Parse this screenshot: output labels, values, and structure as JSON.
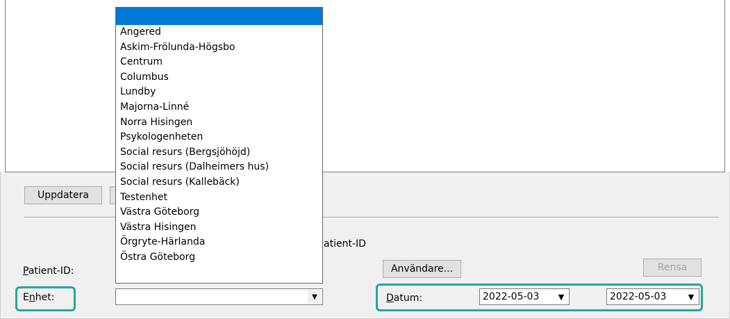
{
  "buttons": {
    "update": "Uppdatera",
    "users": "Användare...",
    "clear": "Rensa"
  },
  "labels": {
    "patient_id": "Patient-ID:",
    "patient_id_partial": "atient-ID",
    "unit": "Enhet:",
    "date": "Datum:"
  },
  "unit_dropdown": {
    "options": [
      "Angered",
      "Askim-Frölunda-Högsbo",
      "Centrum",
      "Columbus",
      "Lundby",
      "Majorna-Linné",
      "Norra Hisingen",
      "Psykologenheten",
      "Social resurs (Bergsjöhöjd)",
      "Social resurs (Dalheimers hus)",
      "Social resurs (Kallebäck)",
      "Testenhet",
      "Västra Göteborg",
      "Västra Hisingen",
      "Örgryte-Härlanda",
      "Östra Göteborg"
    ],
    "selected_value": ""
  },
  "date_range": {
    "from": "2022-05-03",
    "to": "2022-05-03"
  },
  "colors": {
    "selection": "#0078d7",
    "highlight": "#26a69a"
  },
  "icons": {
    "dropdown_arrow": "chevron-down-icon"
  }
}
